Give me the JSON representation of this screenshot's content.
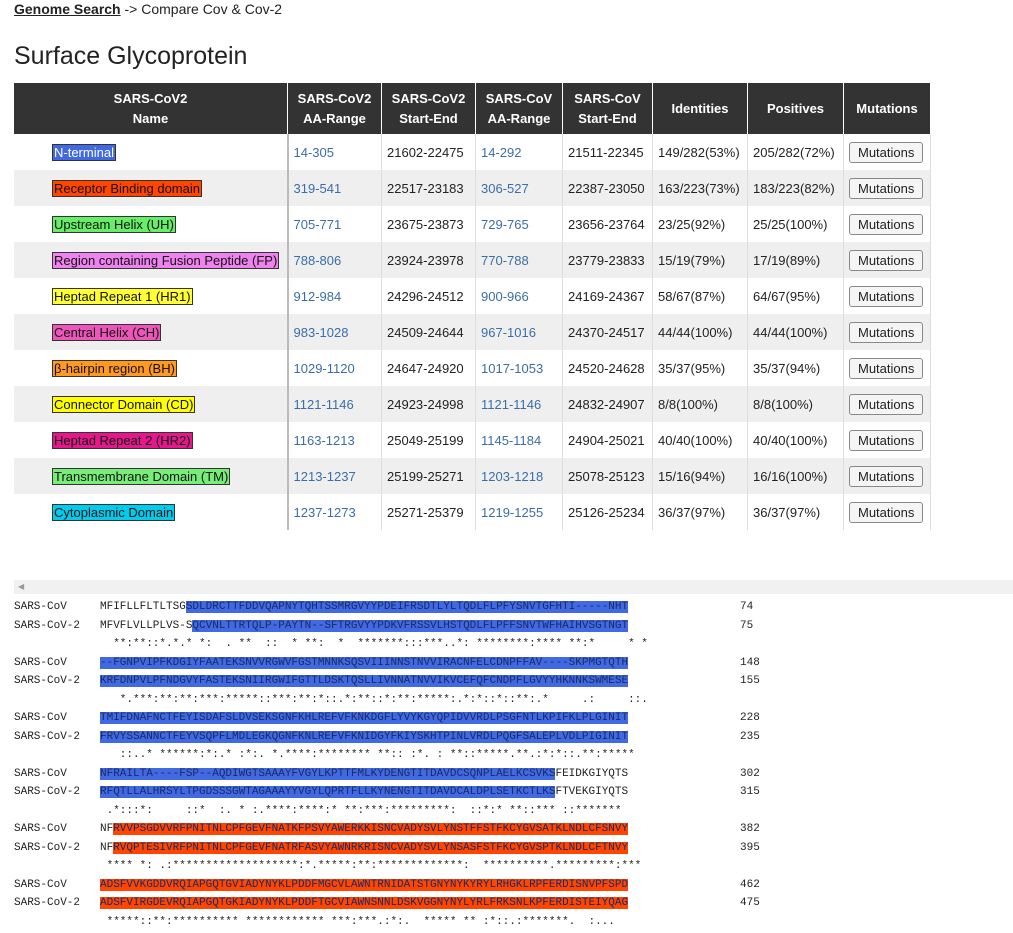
{
  "breadcrumb": {
    "link": "Genome Search",
    "rest": " -> Compare Cov & Cov-2"
  },
  "title": "Surface Glycoprotein",
  "table": {
    "headers": [
      [
        "SARS-CoV2",
        "Name"
      ],
      [
        "SARS-CoV2",
        "AA-Range"
      ],
      [
        "SARS-CoV2",
        "Start-End"
      ],
      [
        "SARS-CoV",
        "AA-Range"
      ],
      [
        "SARS-CoV",
        "Start-End"
      ],
      [
        "Identities",
        ""
      ],
      [
        "Positives",
        ""
      ],
      [
        "Mutations",
        ""
      ]
    ],
    "rows": [
      {
        "name": "N-terminal",
        "color": "#4169e1",
        "fg": "#fff",
        "aa2": "14-305",
        "se2": "21602-22475",
        "aa1": "14-292",
        "se1": "21511-22345",
        "id": "149/282(53%)",
        "pos": "205/282(72%)",
        "btn": "Mutations"
      },
      {
        "name": "Receptor Binding domain",
        "color": "#ff4500",
        "fg": "#111",
        "aa2": "319-541",
        "se2": "22517-23183",
        "aa1": "306-527",
        "se1": "22387-23050",
        "id": "163/223(73%)",
        "pos": "183/223(82%)",
        "btn": "Mutations"
      },
      {
        "name": "Upstream Helix (UH)",
        "color": "#66ee66",
        "fg": "#111",
        "aa2": "705-771",
        "se2": "23675-23873",
        "aa1": "729-765",
        "se1": "23656-23764",
        "id": "23/25(92%)",
        "pos": "25/25(100%)",
        "btn": "Mutations"
      },
      {
        "name": "Region containing Fusion Peptide (FP)",
        "color": "#ee82ee",
        "fg": "#111",
        "aa2": "788-806",
        "se2": "23924-23978",
        "aa1": "770-788",
        "se1": "23779-23833",
        "id": "15/19(79%)",
        "pos": "17/19(89%)",
        "btn": "Mutations"
      },
      {
        "name": "Heptad Repeat 1 (HR1)",
        "color": "#ffff33",
        "fg": "#111",
        "aa2": "912-984",
        "se2": "24296-24512",
        "aa1": "900-966",
        "se1": "24169-24367",
        "id": "58/67(87%)",
        "pos": "64/67(95%)",
        "btn": "Mutations"
      },
      {
        "name": "Central Helix (CH)",
        "color": "#ee55bb",
        "fg": "#111",
        "aa2": "983-1028",
        "se2": "24509-24644",
        "aa1": "967-1016",
        "se1": "24370-24517",
        "id": "44/44(100%)",
        "pos": "44/44(100%)",
        "btn": "Mutations"
      },
      {
        "name": "β-hairpin region (BH)",
        "color": "#ff9922",
        "fg": "#111",
        "aa2": "1029-1120",
        "se2": "24647-24920",
        "aa1": "1017-1053",
        "se1": "24520-24628",
        "id": "35/37(95%)",
        "pos": "35/37(94%)",
        "btn": "Mutations"
      },
      {
        "name": "Connector Domain (CD)",
        "color": "#ffff00",
        "fg": "#111",
        "aa2": "1121-1146",
        "se2": "24923-24998",
        "aa1": "1121-1146",
        "se1": "24832-24907",
        "id": "8/8(100%)",
        "pos": "8/8(100%)",
        "btn": "Mutations"
      },
      {
        "name": "Heptad Repeat 2 (HR2)",
        "color": "#e6168c",
        "fg": "#111",
        "aa2": "1163-1213",
        "se2": "25049-25199",
        "aa1": "1145-1184",
        "se1": "24904-25021",
        "id": "40/40(100%)",
        "pos": "40/40(100%)",
        "btn": "Mutations"
      },
      {
        "name": "Transmembrane Domain (TM)",
        "color": "#77ee77",
        "fg": "#111",
        "aa2": "1213-1237",
        "se2": "25199-25271",
        "aa1": "1203-1218",
        "se1": "25078-25123",
        "id": "15/16(94%)",
        "pos": "16/16(100%)",
        "btn": "Mutations"
      },
      {
        "name": "Cytoplasmic Domain",
        "color": "#00ccee",
        "fg": "#111",
        "aa2": "1237-1273",
        "se2": "25271-25379",
        "aa1": "1219-1255",
        "se1": "25126-25234",
        "id": "36/37(97%)",
        "pos": "36/37(97%)",
        "btn": "Mutations"
      }
    ]
  },
  "alignment": {
    "blocks": [
      {
        "a_name": "SARS-CoV",
        "a_pre": "MFIFLLFLTLTSG",
        "a_hl": "SDLDRCTTFDDVQAPNYTQHTSSMRGVYYPDEIFRSDTLYLTQDLFLPFYSNVTGFHTI-----NHT",
        "a_post": "",
        "a_num": "74",
        "a_color": "#4169e1",
        "b_name": "SARS-CoV-2",
        "b_pre": "MFVFLVLLPLVS-S",
        "b_hl": "QCVNLTTRTQLP-PAYTN--SFTRGVYYPDKVFRSSVLHSTQDLFLPFFSNVTWFHAIHVSGTNGT",
        "b_post": "",
        "b_num": "75",
        "b_color": "#4169e1",
        "cons": "  **:**::*.*.* *:  . **  ::  * **:  *  *******:::***..*: ********:**** **:*     * *"
      },
      {
        "a_name": "SARS-CoV",
        "a_pre": "",
        "a_hl": "--FGNPVIPFKDGIYFAATEKSNVVRGWVFGSTMNNKSQSVIIINNSTNVVIRACNFELCDNPFFAV----SKPMGTQTH",
        "a_post": "",
        "a_num": "148",
        "a_color": "#4169e1",
        "b_name": "SARS-CoV-2",
        "b_pre": "",
        "b_hl": "KRFDNPVLPFNDGVYFASTEKSNIIRGWIFGTTLDSKTQSLLIVNNATNVVIKVCEFQFCNDPFLGVYYHKNNKSWMESE",
        "b_post": "",
        "b_num": "155",
        "b_color": "#4169e1",
        "cons": "   *.***:**:**:***:*****::***:**:*::.*:**::*:**:*****:.*:*::*::**:.*     .:     ::."
      },
      {
        "a_name": "SARS-CoV",
        "a_pre": "",
        "a_hl": "TMIFDNAFNCTFEYISDAFSLDVSEKSGNFKHLREFVFKNKDGFLYVYKGYQPIDVVRDLPSGFNTLKPIFKLPLGINIT",
        "a_post": "",
        "a_num": "228",
        "a_color": "#4169e1",
        "b_name": "SARS-CoV-2",
        "b_pre": "",
        "b_hl": "FRVYSSANNCTFEYVSQPFLMDLEGKQGNFKNLREFVFKNIDGYFKIYSKHTPINLVRDLPQGFSALEPLVDLPIGINIT",
        "b_post": "",
        "b_num": "235",
        "b_color": "#4169e1",
        "cons": "   ::..* ******:*:.* :*:. *.****:******** **:: :*. : **::*****.**.:*:*::.**:*****"
      },
      {
        "a_name": "SARS-CoV",
        "a_pre": "",
        "a_hl": "NFRAILTA----FSP--AQDIWGTSAAAYFVGYLKPTTFMLKYDENGTITDAVDCSQNPLAELKCSVKS",
        "a_post": "FEIDKGIYQTS",
        "a_num": "302",
        "a_color": "#4169e1",
        "b_name": "SARS-CoV-2",
        "b_pre": "",
        "b_hl": "RFQTLLALHRSYLTPGDSSSGWTAGAAAYYVGYLQPRTFLLKYNENGTITDAVDCALDPLSETKCTLKS",
        "b_post": "FTVEKGIYQTS",
        "b_num": "315",
        "b_color": "#4169e1",
        "cons": " .*:::*:     ::*  :. * :.****:****:* **:***:*********:  ::*:* **::*** ::*******"
      },
      {
        "a_name": "SARS-CoV",
        "a_pre": "NF",
        "a_hl": "RVVPSGDVVRFPNITNLCPFGEVFNATKFPSVYAWERKKISNCVADYSVLYNSTFFSTFKCYGVSATKLNDLCFSNVY",
        "a_post": "",
        "a_num": "382",
        "a_color": "#ff4500",
        "b_name": "SARS-CoV-2",
        "b_pre": "NF",
        "b_hl": "RVQPTESIVRFPNITNLCPFGEVFNATRFASVYAWNRKRISNCVADYSVLYNSASFSTFKCYGVSPTKLNDLCFTNVY",
        "b_post": "",
        "b_num": "395",
        "b_color": "#ff4500",
        "cons": " **** *: .:*******************:*.*****:**:*************:  **********.*********:***"
      },
      {
        "a_name": "SARS-CoV",
        "a_pre": "",
        "a_hl": "ADSFVVKGDDVRQIAPGQTGVIADYNYKLPDDFMGCVLAWNTRNIDATSTGNYNYKYRYLRHGKLRPFERDISNVPFSPD",
        "a_post": "",
        "a_num": "462",
        "a_color": "#ff4500",
        "b_name": "SARS-CoV-2",
        "b_pre": "",
        "b_hl": "ADSFVIRGDEVRQIAPGQTGKIADYNYKLPDDFTGCVIAWNSNNLDSKVGGNYNYLYRLFRKSNLKPFERDISTEIYQAG",
        "b_post": "",
        "b_num": "475",
        "b_color": "#ff4500",
        "cons": " *****::**:********** ************ ***:***.:*:.  ***** ** :*::.:*******.  :..."
      }
    ]
  }
}
